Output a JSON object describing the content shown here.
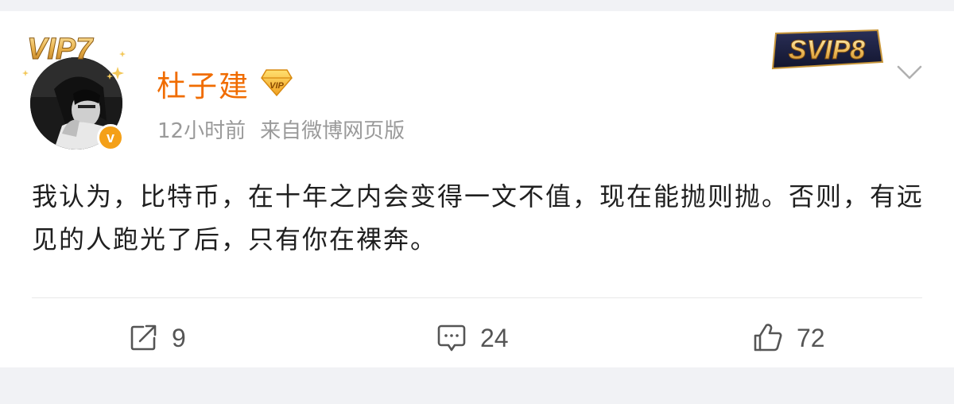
{
  "post": {
    "username": "杜子建",
    "time": "12小时前",
    "source": "来自微博网页版",
    "text": "我认为，比特币，在十年之内会变得一文不值，现在能抛则抛。否则，有远见的人跑光了后，只有你在裸奔。"
  },
  "badges": {
    "frame_vip": "VIP7",
    "member": "SVIP8",
    "verified": "v",
    "gem_vip": "VIP"
  },
  "actions": {
    "repost_count": "9",
    "comment_count": "24",
    "like_count": "72"
  },
  "colors": {
    "username": "#f06c00",
    "meta": "#9a9a9a",
    "badge_gold": "#f4a018",
    "background": "#f1f2f5"
  },
  "icons": {
    "repost": "repost-icon",
    "comment": "comment-icon",
    "like": "thumbs-up-icon",
    "expand": "chevron-down-icon"
  }
}
